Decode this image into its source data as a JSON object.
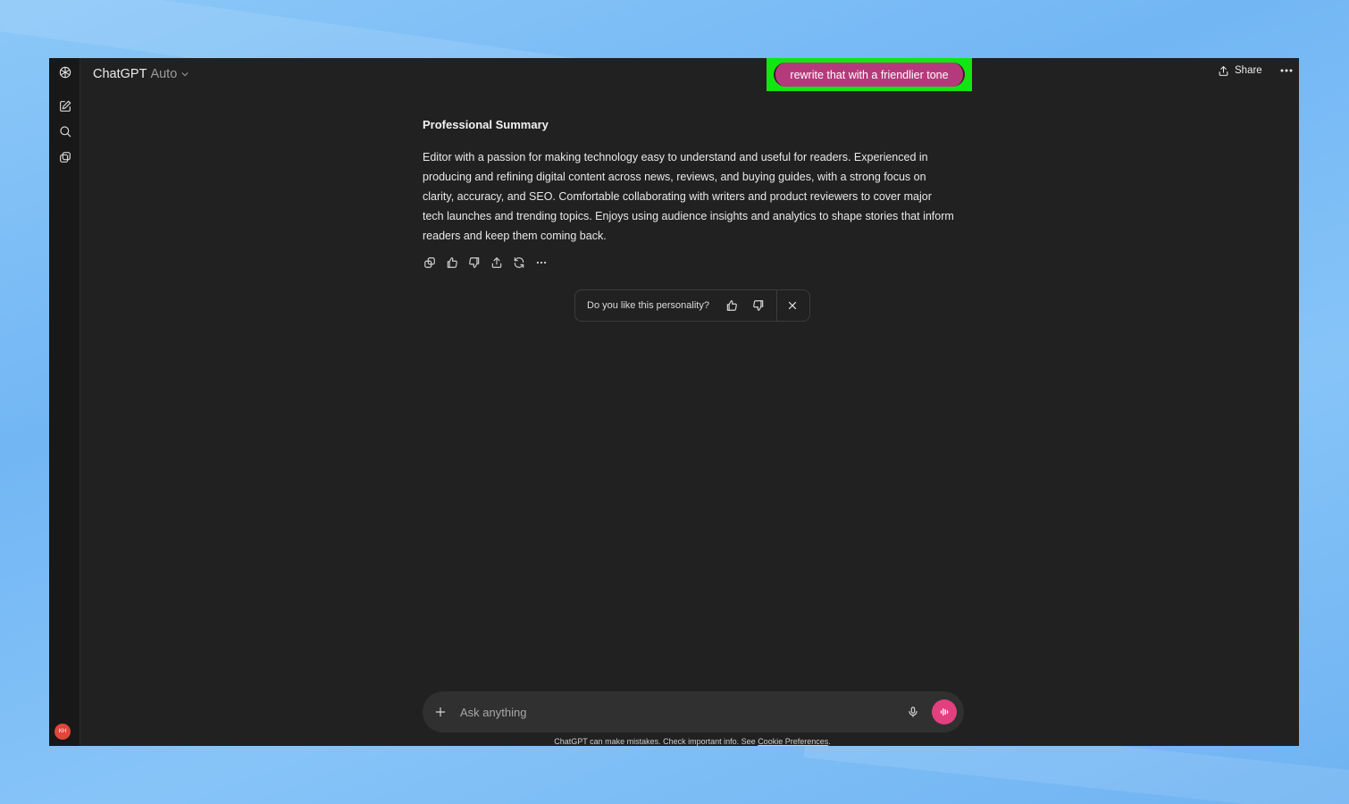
{
  "header": {
    "model_name": "ChatGPT",
    "model_variant": "Auto",
    "share_label": "Share"
  },
  "user_message": {
    "text": "rewrite that with a friendlier tone"
  },
  "assistant_message": {
    "heading": "Professional Summary",
    "body": "Editor with a passion for making technology easy to understand and useful for readers. Experienced in producing and refining digital content across news, reviews, and buying guides, with a strong focus on clarity, accuracy, and SEO. Comfortable collaborating with writers and product reviewers to cover major tech launches and trending topics. Enjoys using audience insights and analytics to shape stories that inform readers and keep them coming back."
  },
  "feedback": {
    "question": "Do you like this personality?"
  },
  "composer": {
    "placeholder": "Ask anything"
  },
  "footer": {
    "disclaimer": "ChatGPT can make mistakes. Check important info. See ",
    "cookie_link": "Cookie Preferences",
    "period": "."
  },
  "user": {
    "initials": "KH"
  },
  "colors": {
    "user_bubble": "#b53a7c",
    "highlight": "#11e611",
    "voice_button": "#e2407f",
    "avatar": "#e0463a",
    "window_bg": "#212121"
  }
}
